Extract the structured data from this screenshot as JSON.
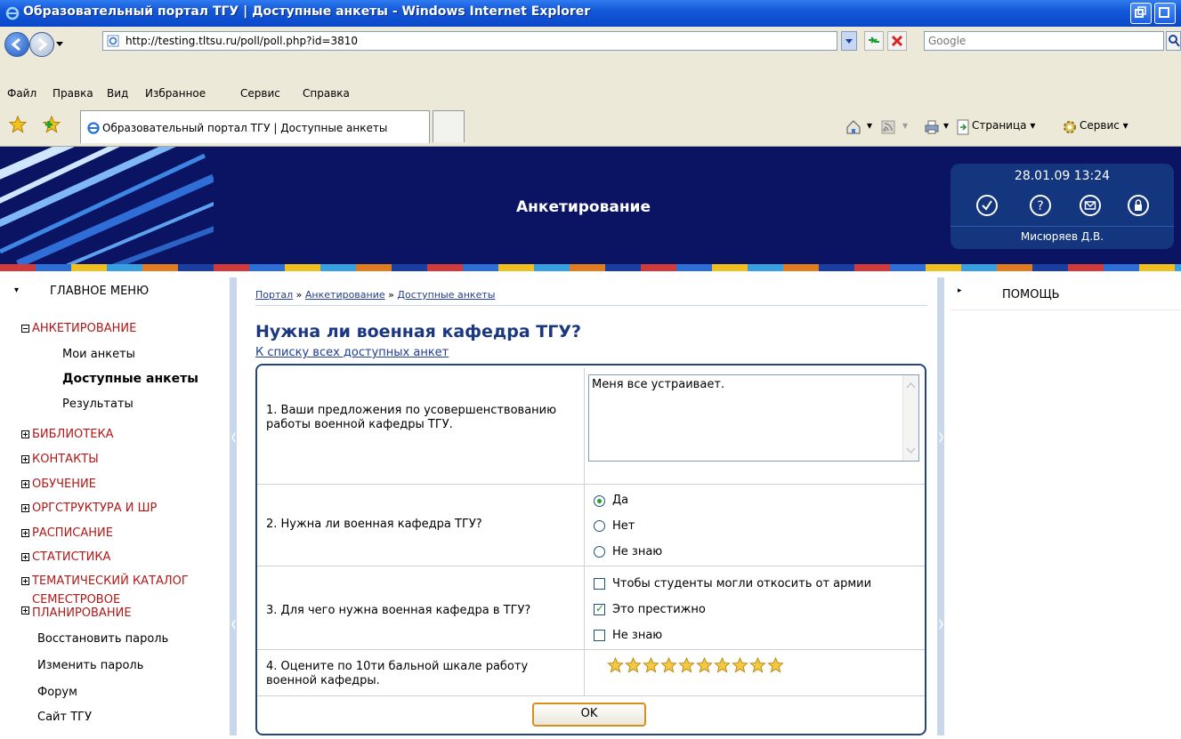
{
  "window": {
    "title": "Образовательный портал ТГУ | Доступные анкеты - Windows Internet Explorer"
  },
  "address_bar": {
    "url": "http://testing.tltsu.ru/poll/poll.php?id=3810"
  },
  "search": {
    "placeholder": "Google"
  },
  "menu": [
    "Файл",
    "Правка",
    "Вид",
    "Избранное",
    "Сервис",
    "Справка"
  ],
  "tabs": [
    {
      "label": "Образовательный портал ТГУ | Доступные анкеты"
    }
  ],
  "command_bar": {
    "page_label": "Страница",
    "tools_label": "Сервис"
  },
  "banner": {
    "title": "Анкетирование",
    "datetime": "28.01.09 13:24",
    "user": "Мисюряев Д.В."
  },
  "left_menu": {
    "header": "ГЛАВНОЕ МЕНЮ",
    "section": "АНКЕТИРОВАНИЕ",
    "section_items": [
      "Мои анкеты",
      "Доступные анкеты",
      "Результаты"
    ],
    "categories": [
      "БИБЛИОТЕКА",
      "КОНТАКТЫ",
      "ОБУЧЕНИЕ",
      "ОРГСТРУКТУРА И ШР",
      "РАСПИСАНИЕ",
      "СТАТИСТИКА",
      "ТЕМАТИЧЕСКИЙ КАТАЛОГ"
    ],
    "semester_line1": "СЕМЕСТРОВОЕ",
    "semester_line2": "ПЛАНИРОВАНИЕ",
    "links": [
      "Восстановить пароль",
      "Изменить пароль",
      "Форум",
      "Сайт ТГУ"
    ]
  },
  "breadcrumb": {
    "items": [
      "Портал",
      "Анкетирование",
      "Доступные анкеты"
    ],
    "separator": "»"
  },
  "poll": {
    "title": "Нужна ли военная кафедра ТГУ?",
    "back_link": "К списку всех доступных анкет",
    "questions": [
      {
        "text": "1. Ваши предложения по усовершенствованию работы военной кафедры ТГУ.",
        "answer": "Меня все устраивает."
      },
      {
        "text": "2. Нужна ли военная кафедра ТГУ?",
        "options": [
          "Да",
          "Нет",
          "Не знаю"
        ],
        "selected": "Да"
      },
      {
        "text": "3. Для чего нужна военная кафедра в ТГУ?",
        "options": [
          "Чтобы студенты могли откосить от армии",
          "Это престижно",
          "Не знаю"
        ],
        "checked": [
          "Это престижно"
        ]
      },
      {
        "text": "4. Оцените по 10ти бальной шкале работу военной кафедры.",
        "rating_max": 10
      }
    ],
    "submit_label": "OK"
  },
  "help": {
    "header": "ПОМОЩЬ"
  },
  "colors": {
    "banner_bg": "#0a1463",
    "category_red": "#b01818",
    "heading_blue": "#1a3780",
    "form_border": "#24457f",
    "button_orange": "#d98e1c"
  }
}
